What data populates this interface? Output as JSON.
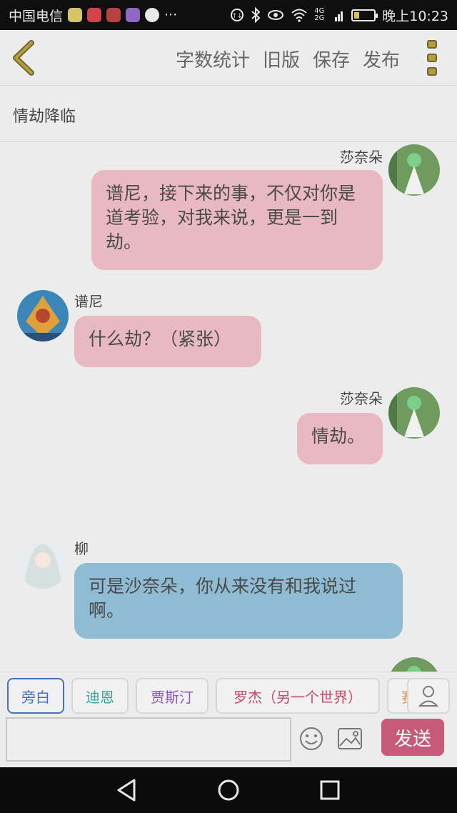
{
  "status_bar": {
    "carrier": "中国电信",
    "more": "···",
    "network": "4G 2G",
    "time": "晚上10:23"
  },
  "header": {
    "actions": [
      "字数统计",
      "旧版",
      "保存",
      "发布"
    ]
  },
  "story_title": "情劫降临",
  "messages": [
    {
      "speaker": "莎奈朵",
      "side": "right",
      "text": "谱尼，接下来的事，不仅对你是道考验，对我来说，更是一到劫。",
      "color": "pink"
    },
    {
      "speaker": "谱尼",
      "side": "left",
      "text": "什么劫？（紧张）",
      "color": "pink"
    },
    {
      "speaker": "莎奈朵",
      "side": "right",
      "text": "情劫。",
      "color": "pink"
    },
    {
      "speaker": "柳",
      "side": "left",
      "text": "可是沙奈朵，你从来没有和我说过啊。",
      "color": "blue"
    }
  ],
  "role_chips": [
    {
      "label": "旁白",
      "color": "#4a6fc2"
    },
    {
      "label": "迪恩",
      "color": "#3aa39a"
    },
    {
      "label": "贾斯汀",
      "color": "#8a59b5"
    },
    {
      "label": "罗杰（另一个世界）",
      "color": "#c24a6a"
    },
    {
      "label": "赛",
      "color": "#d69a5a"
    }
  ],
  "input": {
    "placeholder": "",
    "send_label": "发送"
  },
  "colors": {
    "pink_bubble": "#e9b9c2",
    "blue_bubble": "#8fbcd3",
    "send": "#c75a79",
    "accent": "#b39d3c"
  }
}
